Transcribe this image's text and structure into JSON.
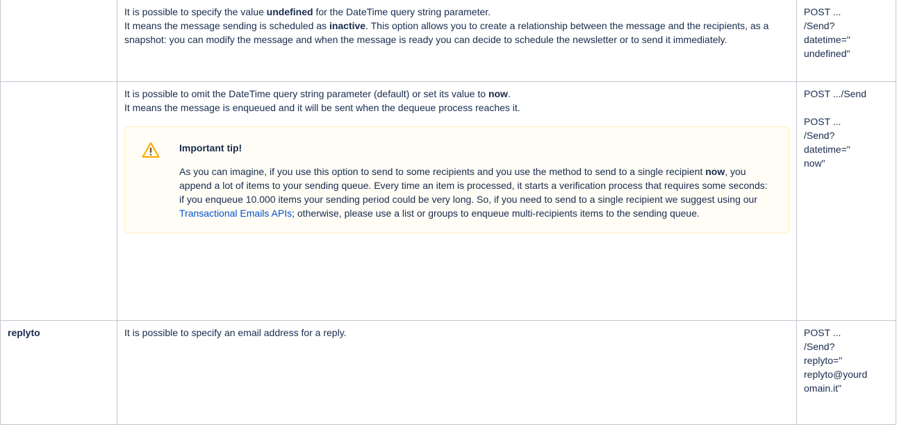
{
  "rows": [
    {
      "param": "",
      "description": {
        "line1_before": "It is possible to specify the value ",
        "line1_bold": "undefined",
        "line1_after": " for the DateTime query string parameter.",
        "line2_before": "It means the message sending is scheduled as ",
        "line2_bold": "inactive",
        "line2_after": ". This option allows you to create a relationship between the message and the recipients, as a snapshot: you can modify the message and when the message is ready you can decide to schedule the newsletter or to send it immediately."
      },
      "example": {
        "l1": "POST ...",
        "l2": "/Send?",
        "l3": "datetime=\"",
        "l4": "undefined\""
      }
    },
    {
      "param": "",
      "description": {
        "line1_before": "It is possible to omit the DateTime query string parameter (default) or set its value to ",
        "line1_bold": "now",
        "line1_after": ".",
        "line2": "It means the message is enqueued and it will be sent when the dequeue process reaches it."
      },
      "tip": {
        "icon": "warning-icon",
        "title": "Important tip!",
        "body_before": "As you can imagine, if you use this option to send to some recipients and you use the method to send to a single recipient ",
        "body_bold": "now",
        "body_middle": ", you append a lot of items to your sending queue. Every time an item is processed, it starts a verification process that requires some seconds: if you enqueue 10.000 items your sending period could be very long. So, if you need to send to a single recipient we suggest using our ",
        "link_text": "Transactional Emails APIs",
        "body_after": "; otherwise, please use a list or groups to enqueue multi-recipients items to the sending queue."
      },
      "example": {
        "first": "POST .../Send",
        "l1": "POST ...",
        "l2": "/Send?",
        "l3": "datetime=\"",
        "l4": "now\""
      }
    },
    {
      "param": "replyto",
      "description": {
        "line1": "It is possible to specify an email address for a reply."
      },
      "example": {
        "l1": "POST ...",
        "l2": "/Send?",
        "l3": "replyto=\"",
        "l4": "replyto@yourd",
        "l5": "omain.it\""
      }
    }
  ],
  "colors": {
    "border": "#c1c7d0",
    "text": "#172b4d",
    "link": "#0052cc",
    "tip_bg": "#fffdf6",
    "tip_border": "#ffeeb4",
    "warning": "#ffab00"
  }
}
